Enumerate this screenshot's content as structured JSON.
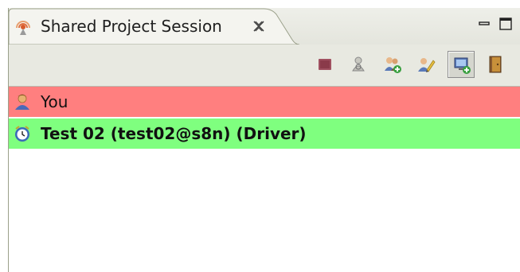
{
  "view": {
    "title": "Shared Project Session",
    "tab_icon": "broadcast-session-icon",
    "close_icon": "close-x-icon",
    "controls": [
      "minimize-icon",
      "maximize-icon"
    ]
  },
  "toolbar": {
    "buttons": [
      {
        "icon": "stop-session-icon",
        "pressed": false
      },
      {
        "icon": "restrict-write-icon",
        "pressed": false
      },
      {
        "icon": "add-buddy-icon",
        "pressed": false
      },
      {
        "icon": "give-driver-icon",
        "pressed": false
      },
      {
        "icon": "share-screen-icon",
        "pressed": true
      },
      {
        "icon": "leave-session-icon",
        "pressed": false
      }
    ]
  },
  "participants": [
    {
      "label": "You",
      "icon": "user-icon",
      "bg": "#ff7f7f",
      "bold": false
    },
    {
      "label": "Test 02 (test02@s8n) (Driver)",
      "icon": "clock-driver-icon",
      "bg": "#7fff7f",
      "bold": true
    }
  ],
  "colors": {
    "you_row": "#ff7f7f",
    "driver_row": "#7fff7f",
    "tab_bg": "#f2f2ec",
    "toolbar_bg": "#e8e9e1"
  }
}
